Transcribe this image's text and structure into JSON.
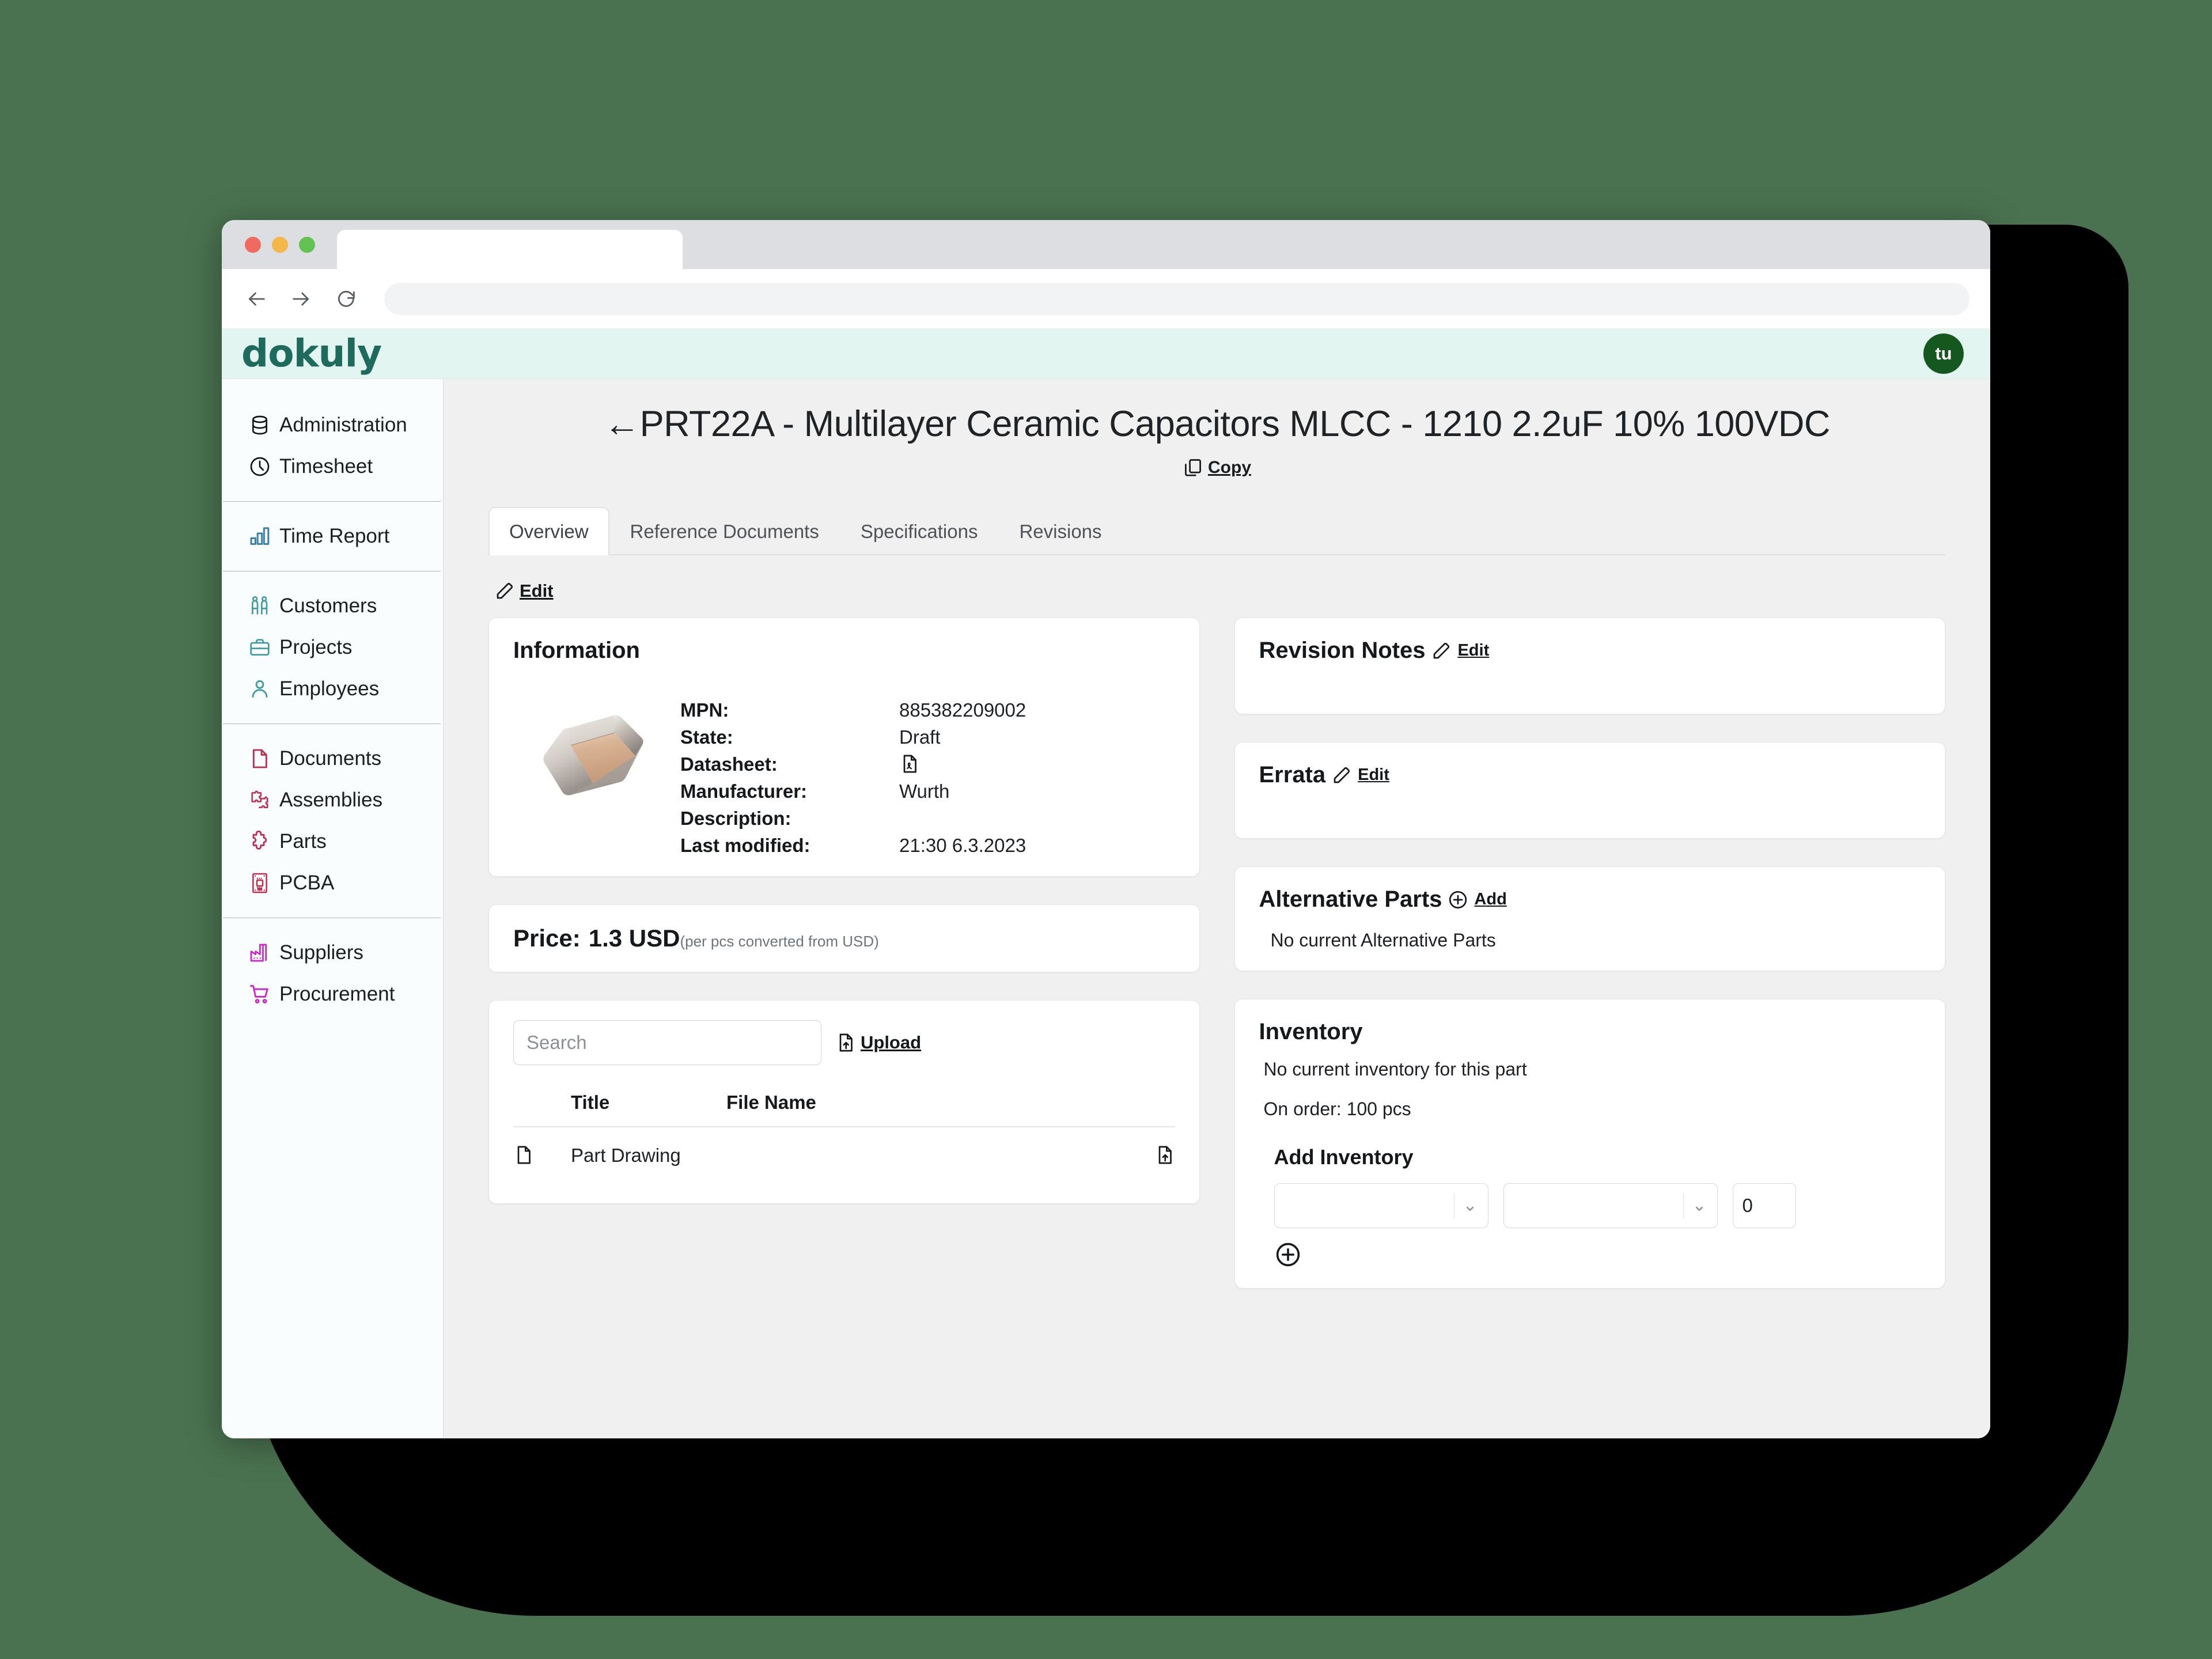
{
  "browser": {
    "back_icon": "back-arrow-icon",
    "forward_icon": "forward-arrow-icon",
    "reload_icon": "reload-icon",
    "address_value": "",
    "tab_title": ""
  },
  "app": {
    "logo_text": "dokuly",
    "avatar_initials": "tu",
    "brand_color": "#1e6a5c",
    "header_bg": "#e2f5f0",
    "avatar_bg": "#14581f"
  },
  "sidebar": {
    "groups": [
      {
        "items": [
          {
            "label": "Administration",
            "icon": "database-icon",
            "color": "#111315"
          },
          {
            "label": "Timesheet",
            "icon": "clock-icon",
            "color": "#111315"
          }
        ]
      },
      {
        "items": [
          {
            "label": "Time Report",
            "icon": "bar-chart-icon",
            "color": "#3b7fa8"
          }
        ]
      },
      {
        "items": [
          {
            "label": "Customers",
            "icon": "people-icon",
            "color": "#3f9aa8"
          },
          {
            "label": "Projects",
            "icon": "briefcase-icon",
            "color": "#3f9aa8"
          },
          {
            "label": "Employees",
            "icon": "person-icon",
            "color": "#3f9aa8"
          }
        ]
      },
      {
        "items": [
          {
            "label": "Documents",
            "icon": "document-icon",
            "color": "#bf2d4e"
          },
          {
            "label": "Assemblies",
            "icon": "puzzle-pieces-icon",
            "color": "#bf2d4e"
          },
          {
            "label": "Parts",
            "icon": "puzzle-piece-icon",
            "color": "#bf2d4e"
          },
          {
            "label": "PCBA",
            "icon": "circuit-board-icon",
            "color": "#bf2d4e"
          }
        ]
      },
      {
        "items": [
          {
            "label": "Suppliers",
            "icon": "factory-icon",
            "color": "#cc22cc"
          },
          {
            "label": "Procurement",
            "icon": "shopping-cart-icon",
            "color": "#cc22cc"
          }
        ]
      }
    ]
  },
  "page": {
    "back_arrow": "←",
    "title": "PRT22A - Multilayer Ceramic Capacitors MLCC - 1210 2.2uF 10% 100VDC",
    "copy_label": "Copy",
    "copy_icon": "copy-icon"
  },
  "tabs": [
    {
      "label": "Overview",
      "active": true
    },
    {
      "label": "Reference Documents",
      "active": false
    },
    {
      "label": "Specifications",
      "active": false
    },
    {
      "label": "Revisions",
      "active": false
    }
  ],
  "edit_link": {
    "label": "Edit",
    "icon": "pencil-square-icon"
  },
  "information": {
    "title": "Information",
    "image_alt": "mlcc-capacitor-photo",
    "rows": [
      {
        "key": "MPN:",
        "value": "885382209002"
      },
      {
        "key": "State:",
        "value": "Draft"
      },
      {
        "key": "Datasheet:",
        "value": "",
        "icon": "pdf-file-icon"
      },
      {
        "key": "Manufacturer:",
        "value": "Wurth"
      },
      {
        "key": "Description:",
        "value": ""
      },
      {
        "key": "Last modified:",
        "value": "21:30 6.3.2023"
      }
    ]
  },
  "price": {
    "label": "Price:",
    "amount": "1.3 USD",
    "note": "(per pcs converted from USD)"
  },
  "files": {
    "search_placeholder": "Search",
    "search_value": "",
    "upload_label": "Upload",
    "upload_icon": "file-upload-icon",
    "columns": [
      "",
      "Title",
      "File Name",
      ""
    ],
    "rows": [
      {
        "icon": "file-icon",
        "title": "Part Drawing",
        "file_name": "",
        "action_icon": "file-upload-icon"
      }
    ]
  },
  "revision_notes": {
    "title": "Revision Notes",
    "edit_label": "Edit",
    "edit_icon": "pencil-square-icon",
    "body": ""
  },
  "errata": {
    "title": "Errata",
    "edit_label": "Edit",
    "edit_icon": "pencil-square-icon",
    "body": ""
  },
  "alternative_parts": {
    "title": "Alternative Parts",
    "add_label": "Add",
    "add_icon": "plus-circle-icon",
    "empty_text": "No current Alternative Parts"
  },
  "inventory": {
    "title": "Inventory",
    "empty_text": "No current inventory for this part",
    "on_order_text": "On order: 100 pcs",
    "add_title": "Add Inventory",
    "select1_value": "",
    "select2_value": "",
    "quantity_value": "0",
    "add_button_icon": "plus-circle-icon"
  }
}
